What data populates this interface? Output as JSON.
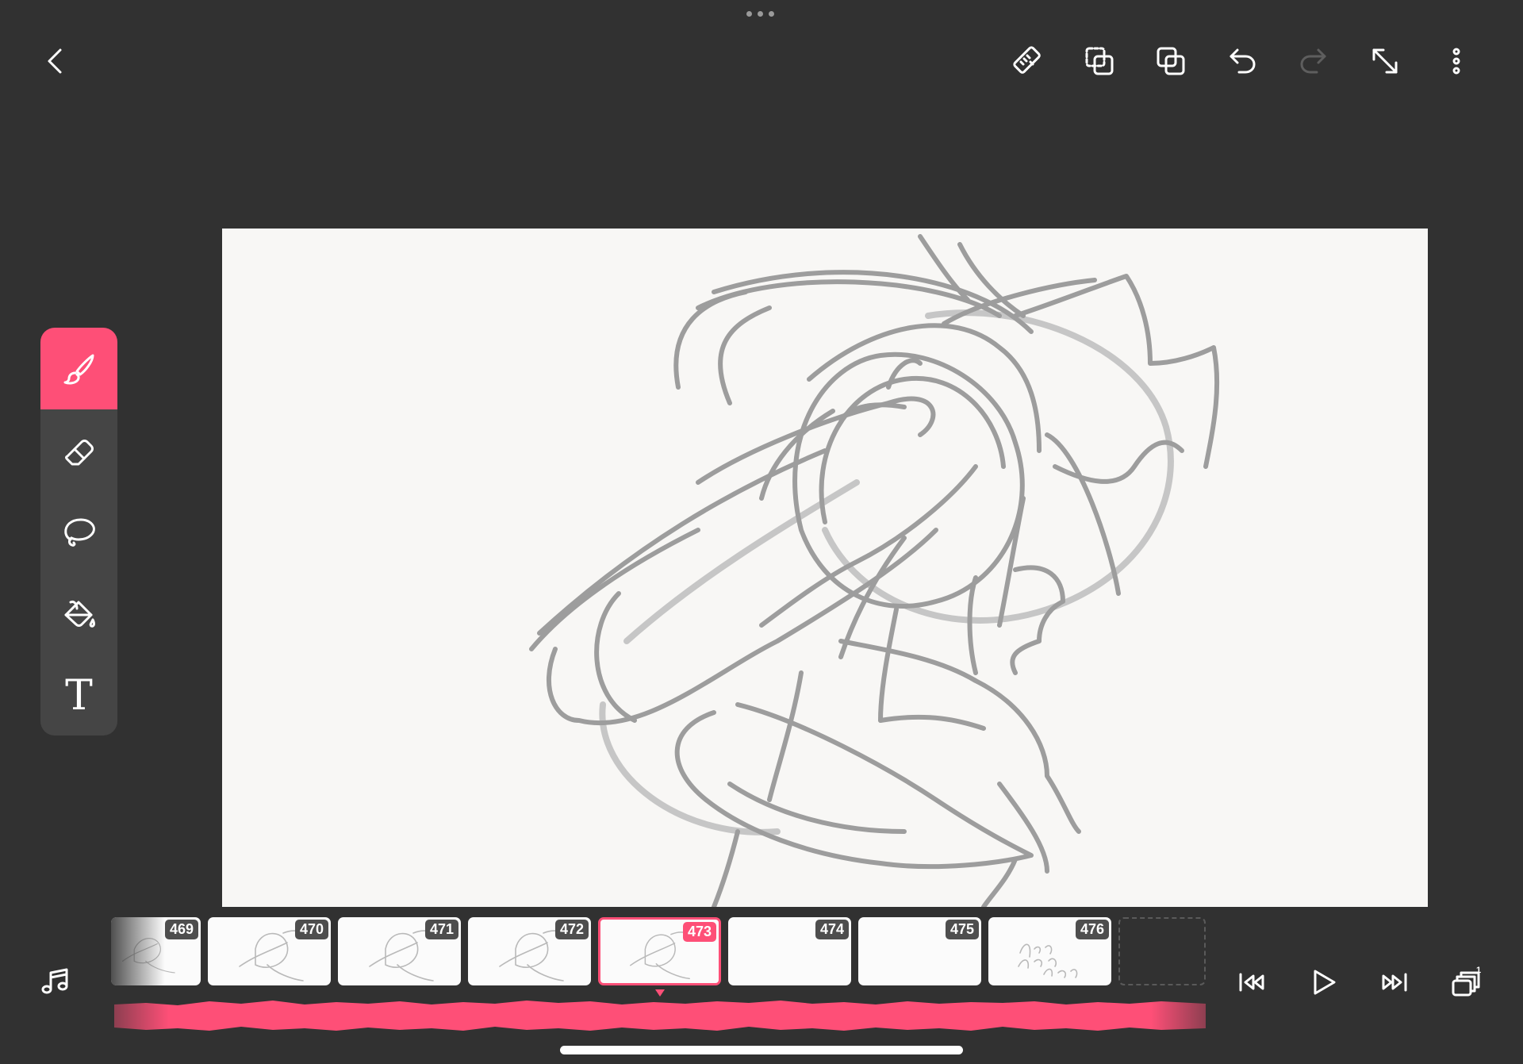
{
  "app": {
    "accent_color": "#fe4f77",
    "background_color": "#313131"
  },
  "top_bar": {
    "left": [
      {
        "name": "back-button",
        "icon": "chevron-left-icon"
      }
    ],
    "right": [
      {
        "name": "ruler-button",
        "icon": "ruler-icon"
      },
      {
        "name": "paste-button",
        "icon": "paste-dashed-icon"
      },
      {
        "name": "duplicate-button",
        "icon": "duplicate-icon"
      },
      {
        "name": "undo-button",
        "icon": "undo-icon"
      },
      {
        "name": "redo-button",
        "icon": "redo-icon",
        "disabled": true
      },
      {
        "name": "fullscreen-button",
        "icon": "expand-diagonal-icon"
      },
      {
        "name": "more-button",
        "icon": "more-vertical-icon"
      }
    ]
  },
  "tools": [
    {
      "name": "brush-tool",
      "icon": "brush-icon",
      "active": true
    },
    {
      "name": "eraser-tool",
      "icon": "eraser-icon",
      "active": false
    },
    {
      "name": "lasso-tool",
      "icon": "lasso-icon",
      "active": false
    },
    {
      "name": "fill-tool",
      "icon": "paint-bucket-icon",
      "active": false
    },
    {
      "name": "text-tool",
      "icon": "text-icon",
      "label": "T",
      "active": false
    }
  ],
  "timeline": {
    "current_frame": "473",
    "frames": [
      {
        "number": "469",
        "has_drawing": true
      },
      {
        "number": "470",
        "has_drawing": true
      },
      {
        "number": "471",
        "has_drawing": true
      },
      {
        "number": "472",
        "has_drawing": true
      },
      {
        "number": "473",
        "has_drawing": true,
        "active": true
      },
      {
        "number": "474",
        "has_drawing": false
      },
      {
        "number": "475",
        "has_drawing": false
      },
      {
        "number": "476",
        "has_drawing": true
      }
    ]
  },
  "playback": [
    {
      "name": "music-button",
      "icon": "music-note-icon"
    },
    {
      "name": "jump-start-button",
      "icon": "skip-back-icon"
    },
    {
      "name": "play-button",
      "icon": "play-icon"
    },
    {
      "name": "jump-end-button",
      "icon": "skip-forward-icon"
    },
    {
      "name": "layers-button",
      "icon": "layers-icon",
      "badge": "1"
    }
  ]
}
